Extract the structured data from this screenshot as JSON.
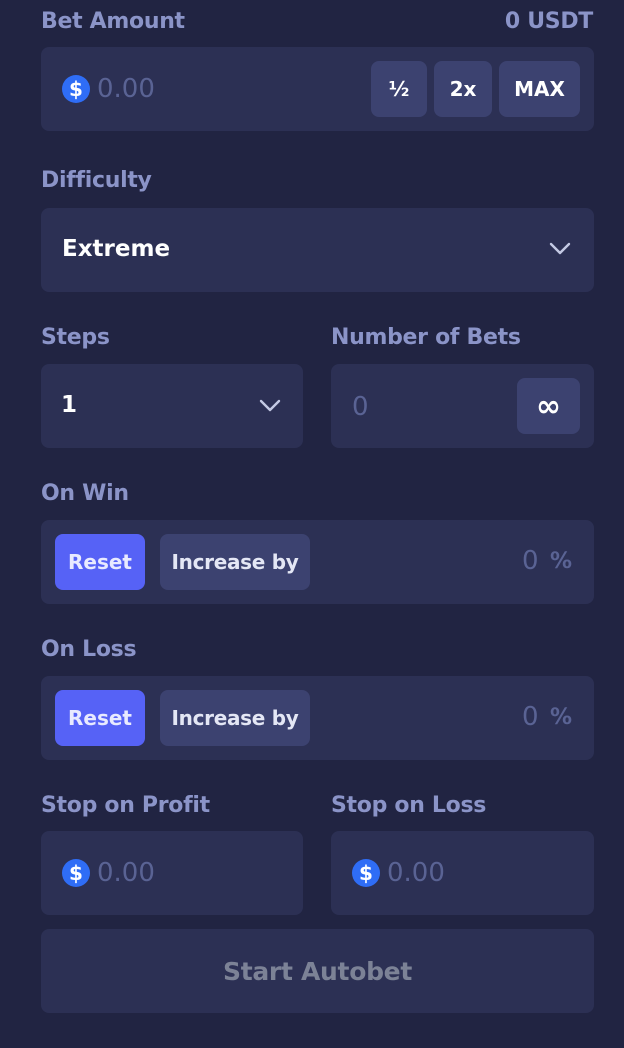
{
  "bet_amount": {
    "label": "Bet Amount",
    "balance": "0 USDT",
    "currency_symbol": "$",
    "placeholder": "0.00",
    "half_label": "½",
    "double_label": "2x",
    "max_label": "MAX"
  },
  "difficulty": {
    "label": "Difficulty",
    "selected": "Extreme"
  },
  "steps": {
    "label": "Steps",
    "selected": "1"
  },
  "number_of_bets": {
    "label": "Number of Bets",
    "value": "0",
    "infinity_label": "∞"
  },
  "on_win": {
    "label": "On Win",
    "reset_label": "Reset",
    "increase_label": "Increase by",
    "value": "0",
    "unit": "%"
  },
  "on_loss": {
    "label": "On Loss",
    "reset_label": "Reset",
    "increase_label": "Increase by",
    "value": "0",
    "unit": "%"
  },
  "stop_on_profit": {
    "label": "Stop on Profit",
    "currency_symbol": "$",
    "placeholder": "0.00"
  },
  "stop_on_loss": {
    "label": "Stop on Loss",
    "currency_symbol": "$",
    "placeholder": "0.00"
  },
  "start_button": {
    "label": "Start Autobet"
  },
  "colors": {
    "background": "#212442",
    "field": "#2c3054",
    "accent": "#5662f6",
    "coin": "#2f6df6",
    "label": "#8b94c8"
  }
}
